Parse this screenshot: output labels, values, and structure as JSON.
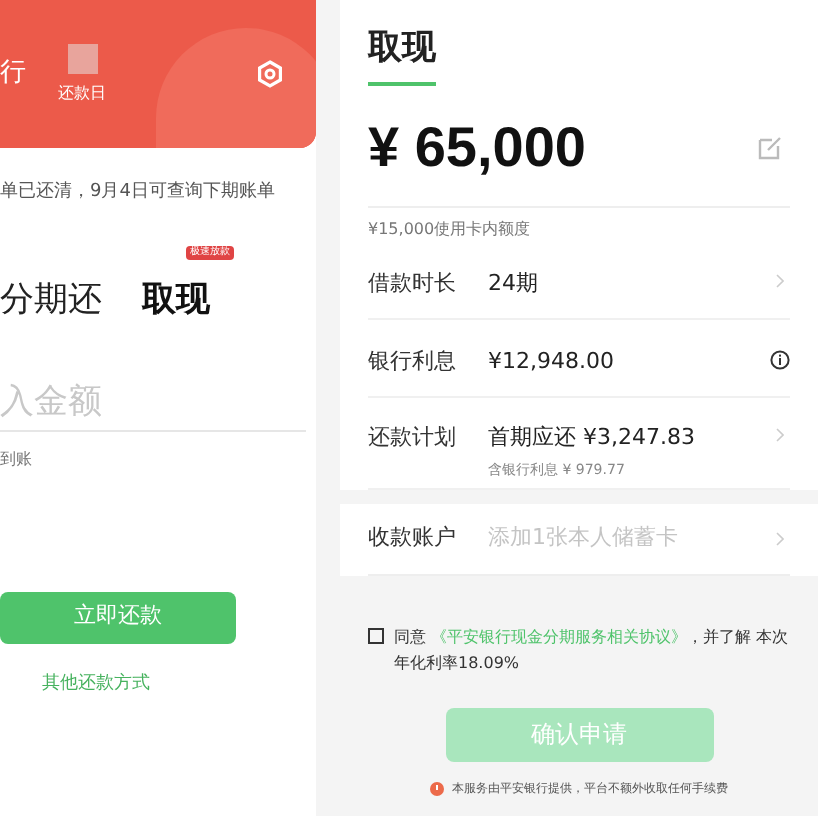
{
  "left_screen": {
    "card": {
      "bank_fragment": "行",
      "due_label": "还款日"
    },
    "notice": "单已还清，9月4日可查询下期账单",
    "tabs": [
      {
        "label": "分期还",
        "selected": false
      },
      {
        "label": "取现",
        "selected": true,
        "badge": "极速放款"
      }
    ],
    "amount_field": {
      "placeholder": "入金额"
    },
    "hint": "到账",
    "pay_button": "立即还款",
    "other_link": "其他还款方式"
  },
  "right_screen": {
    "title": "取现",
    "amount": "¥ 65,000",
    "limit_note": "¥15,000使用卡内额度",
    "rows": [
      {
        "kind": "chevron",
        "label": "借款时长",
        "value": "24期"
      },
      {
        "kind": "info",
        "label": "银行利息",
        "value": "¥12,948.00"
      },
      {
        "kind": "chevron",
        "label": "还款计划",
        "value": "首期应还 ¥3,247.83",
        "sub": "含银行利息 ¥ 979.77"
      }
    ],
    "account_row": {
      "label": "收款账户",
      "placeholder": "添加1张本人储蓄卡"
    },
    "agreement": {
      "checked": false,
      "prefix": "同意",
      "link": "《平安银行现金分期服务相关协议》",
      "suffix": "，并了解 本次年化利率18.09%"
    },
    "confirm_button": {
      "label": "确认申请",
      "disabled": true
    },
    "footer_note": "本服务由平安银行提供，平台不额外收取任何手续费"
  }
}
